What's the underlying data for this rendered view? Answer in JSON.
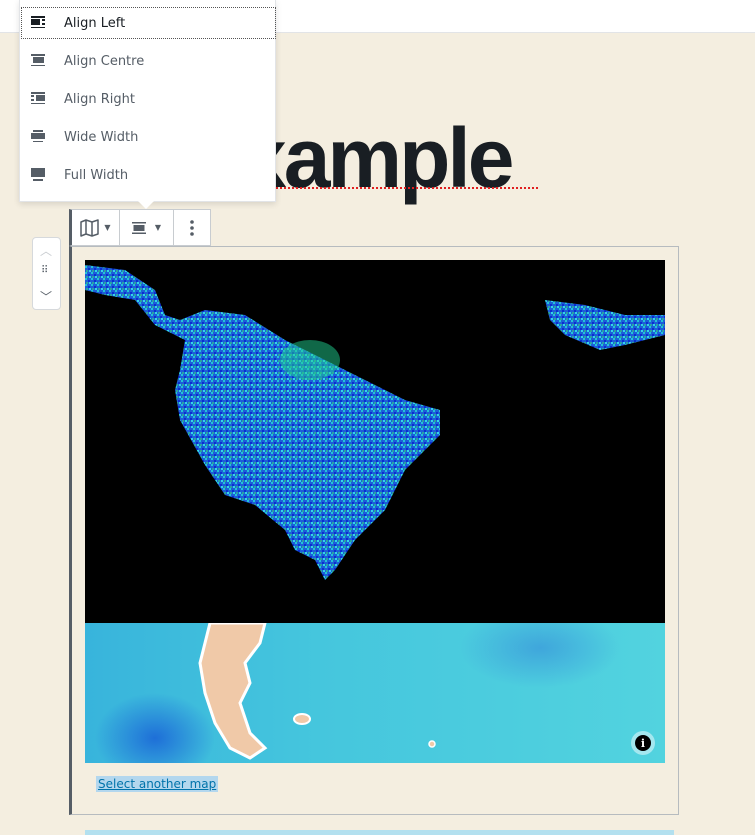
{
  "post": {
    "title_visible": "xample"
  },
  "alignment_menu": {
    "items": [
      {
        "label": "Align Left",
        "icon": "align-left-icon",
        "active": true
      },
      {
        "label": "Align Centre",
        "icon": "align-center-icon",
        "active": false
      },
      {
        "label": "Align Right",
        "icon": "align-right-icon",
        "active": false
      },
      {
        "label": "Wide Width",
        "icon": "align-wide-icon",
        "active": false
      },
      {
        "label": "Full Width",
        "icon": "align-full-icon",
        "active": false
      }
    ]
  },
  "block_toolbar": {
    "block_type_icon": "map-icon",
    "alignment_icon": "align-center-icon",
    "more_icon": "more-vertical-icon"
  },
  "block_mover": {
    "up_icon": "chevron-up-icon",
    "drag_icon": "drag-handle-icon",
    "down_icon": "chevron-down-icon"
  },
  "map_block": {
    "select_link": "Select another map",
    "info_icon": "info-icon",
    "colors": {
      "ocean": "#45c6dd",
      "land": "#f0c9a8",
      "vegetation_bg": "#000000"
    }
  }
}
